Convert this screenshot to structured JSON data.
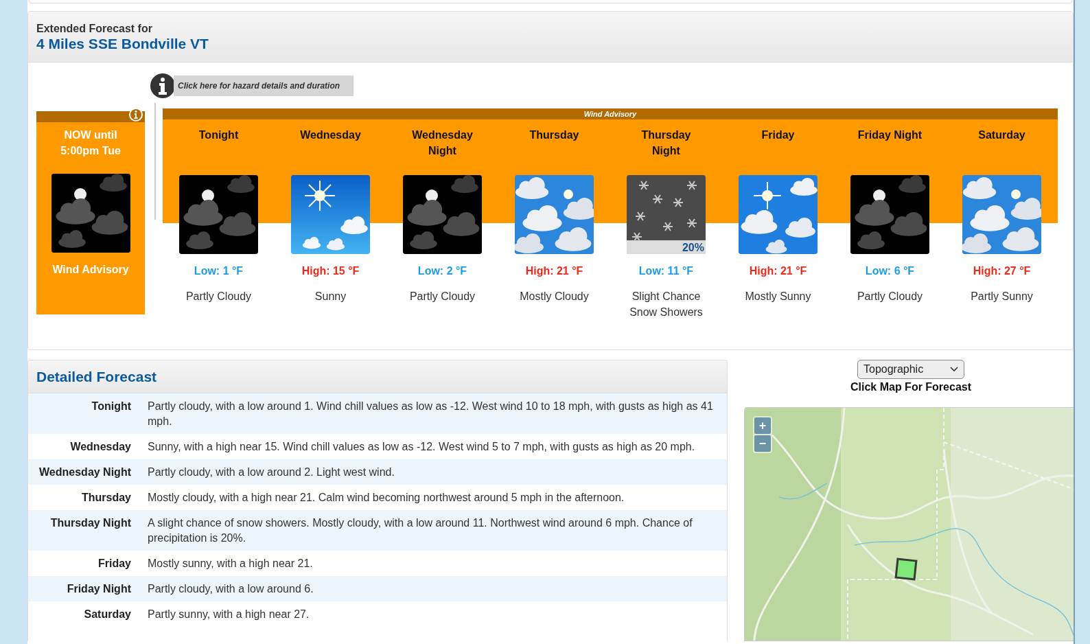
{
  "extended_forecast": {
    "heading": "Extended Forecast for",
    "location": "4 Miles SSE Bondville VT",
    "hazard_link": {
      "label": "Click here for hazard details and duration"
    },
    "current_hazard": {
      "period": "NOW until 5:00pm Tue",
      "kind": "night_partly_cloudy",
      "hazard": "Wind Advisory"
    },
    "advisory_band": {
      "label": "Wind Advisory"
    },
    "periods": [
      {
        "name": "Tonight",
        "kind": "night_partly_cloudy",
        "color": "#1e9be5",
        "temp": "Low: 1 °F",
        "description": "Partly Cloudy"
      },
      {
        "name": "Wednesday",
        "kind": "sunny",
        "color": "#ee2a1a",
        "temp": "High: 15 °F",
        "description": "Sunny"
      },
      {
        "name": "Wednesday Night",
        "kind": "night_partly_cloudy",
        "color": "#1e9be5",
        "temp": "Low: 2 °F",
        "description": "Partly Cloudy"
      },
      {
        "name": "Thursday",
        "kind": "mostly_cloudy",
        "color": "#ee2a1a",
        "temp": "High: 21 °F",
        "description": "Mostly Cloudy"
      },
      {
        "name": "Thursday Night",
        "kind": "snow",
        "pop": "20%",
        "color": "#1e9be5",
        "temp": "Low: 11 °F",
        "description": "Slight Chance Snow Showers"
      },
      {
        "name": "Friday",
        "kind": "mostly_sunny",
        "color": "#ee2a1a",
        "temp": "High: 21 °F",
        "description": "Mostly Sunny"
      },
      {
        "name": "Friday Night",
        "kind": "night_partly_cloudy",
        "color": "#1e9be5",
        "temp": "Low: 6 °F",
        "description": "Partly Cloudy"
      },
      {
        "name": "Saturday",
        "kind": "mostly_cloudy",
        "color": "#ee2a1a",
        "temp": "High: 27 °F",
        "description": "Partly Sunny"
      }
    ]
  },
  "detailed_forecast": {
    "title": "Detailed Forecast",
    "rows": [
      {
        "label": "Tonight",
        "text": "Partly cloudy, with a low around 1. Wind chill values as low as -12. West wind 10 to 18 mph, with gusts as high as 41 mph."
      },
      {
        "label": "Wednesday",
        "text": "Sunny, with a high near 15. Wind chill values as low as -12. West wind 5 to 7 mph, with gusts as high as 20 mph."
      },
      {
        "label": "Wednesday Night",
        "text": "Partly cloudy, with a low around 2. Light west wind."
      },
      {
        "label": "Thursday",
        "text": "Mostly cloudy, with a high near 21. Calm wind becoming northwest around 5 mph in the afternoon."
      },
      {
        "label": "Thursday Night",
        "text": "A slight chance of snow showers. Mostly cloudy, with a low around 11. Northwest wind around 6 mph. Chance of precipitation is 20%."
      },
      {
        "label": "Friday",
        "text": "Mostly sunny, with a high near 21."
      },
      {
        "label": "Friday Night",
        "text": "Partly cloudy, with a low around 6."
      },
      {
        "label": "Saturday",
        "text": "Partly sunny, with a high near 27."
      }
    ]
  },
  "map_panel": {
    "map_type": "Topographic",
    "caption": "Click Map For Forecast",
    "zoom_in": "+",
    "zoom_out": "−"
  }
}
